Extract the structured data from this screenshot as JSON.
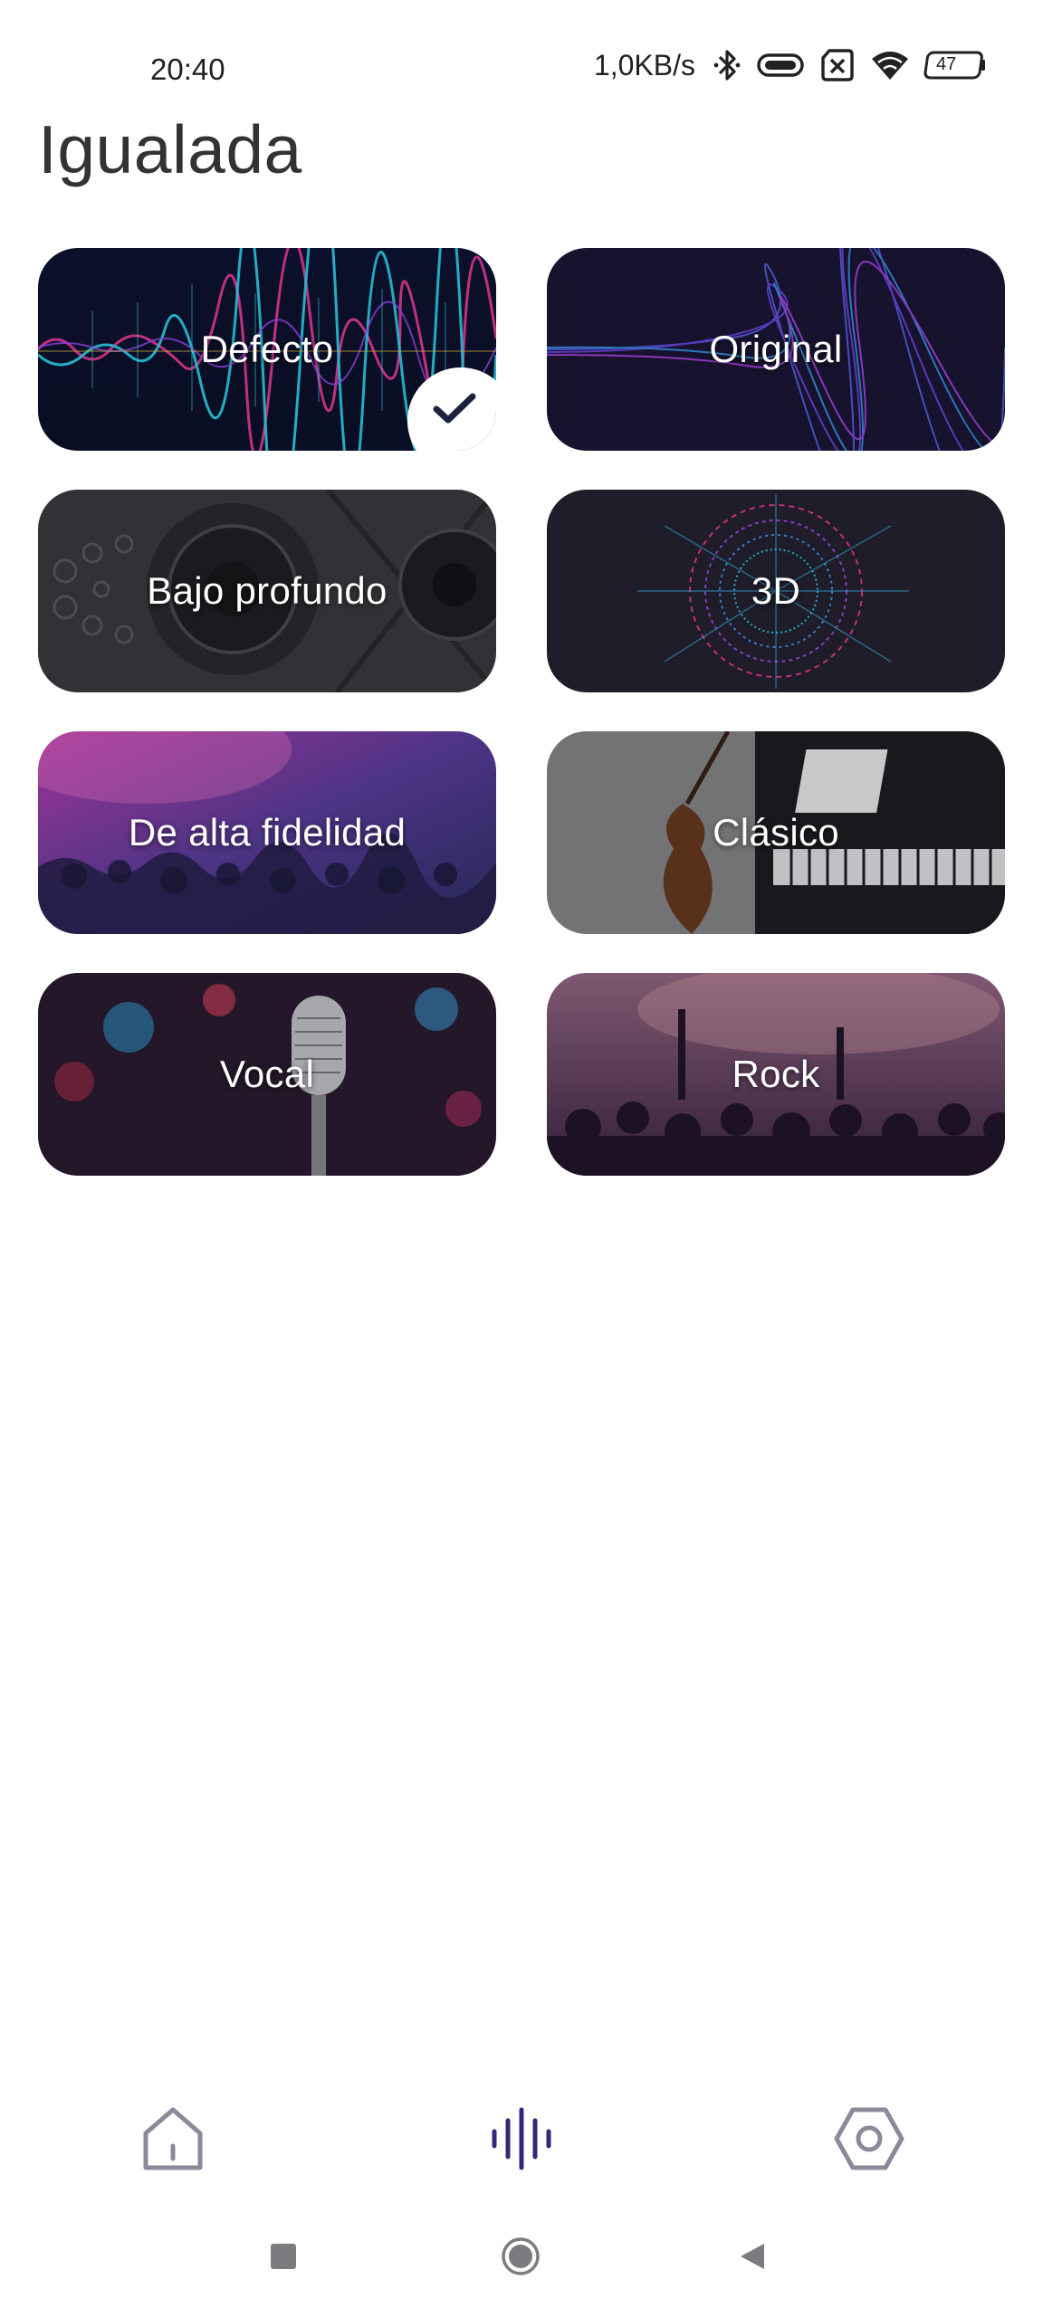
{
  "status_bar": {
    "time": "20:40",
    "network_speed": "1,0KB/s",
    "battery_level": "47",
    "icons": [
      "bluetooth-icon",
      "vibrate-icon",
      "no-sim-icon",
      "wifi-icon",
      "battery-icon"
    ]
  },
  "title": "Igualada",
  "presets": [
    {
      "label": "Defecto",
      "selected": true
    },
    {
      "label": "Original",
      "selected": false
    },
    {
      "label": "Bajo profundo",
      "selected": false
    },
    {
      "label": "3D",
      "selected": false
    },
    {
      "label": "De alta fidelidad",
      "selected": false
    },
    {
      "label": "Clásico",
      "selected": false
    },
    {
      "label": "Vocal",
      "selected": false
    },
    {
      "label": "Rock",
      "selected": false
    }
  ],
  "bottom_nav": {
    "items": [
      "home-icon",
      "equalizer-icon",
      "settings-icon"
    ],
    "active": "equalizer-icon",
    "active_color": "#2f2a7a",
    "inactive_color": "#8a8a9a"
  },
  "system_nav": [
    "recents-icon",
    "home-circle-icon",
    "back-icon"
  ]
}
